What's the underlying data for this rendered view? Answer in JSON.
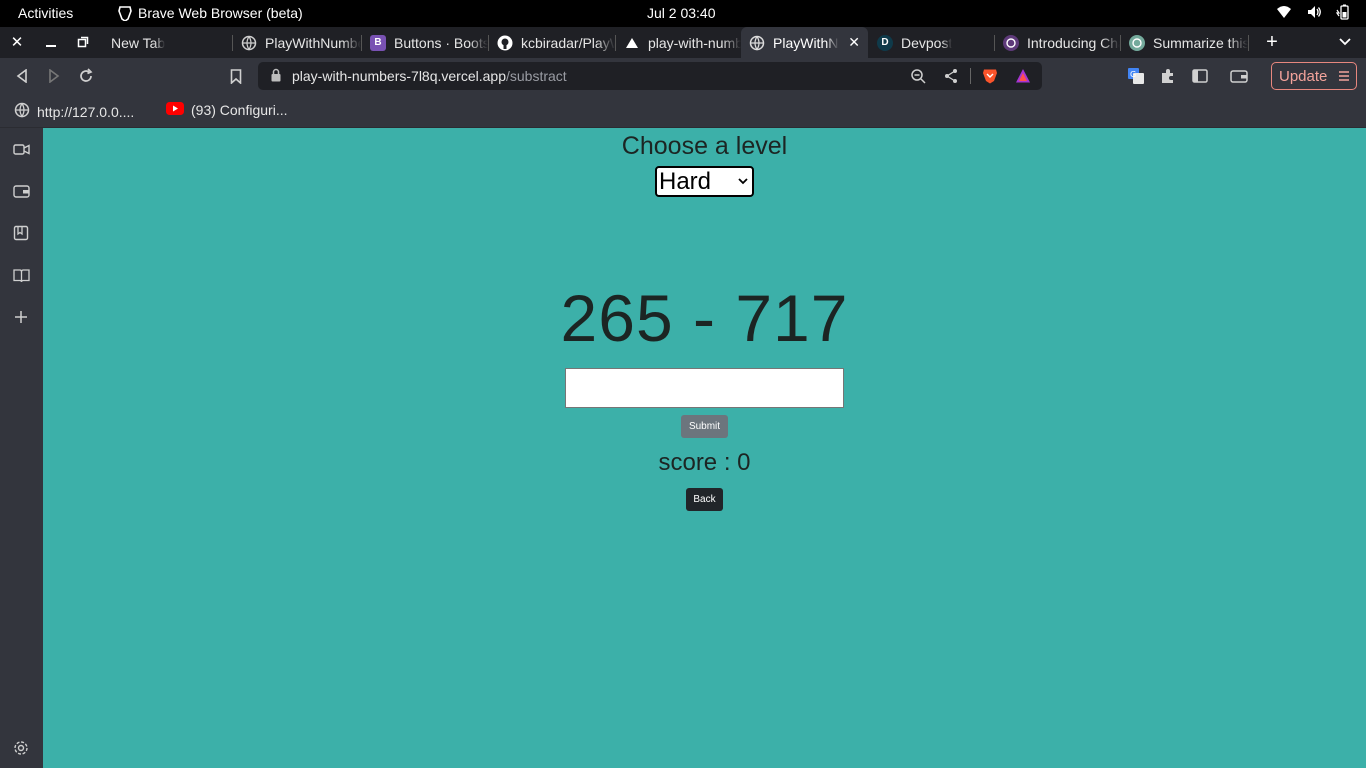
{
  "system": {
    "activities": "Activities",
    "app_name": "Brave Web Browser (beta)",
    "clock": "Jul 2  03:40"
  },
  "tabs": [
    {
      "title": "New Tab",
      "active": false
    },
    {
      "title": "PlayWithNumbers",
      "active": false
    },
    {
      "title": "Buttons · Bootstrap",
      "active": false
    },
    {
      "title": "kcbiradar/PlayWithNumbers",
      "active": false
    },
    {
      "title": "play-with-numbers",
      "active": false
    },
    {
      "title": "PlayWithNumbers",
      "active": true
    },
    {
      "title": "Devpost",
      "active": false
    },
    {
      "title": "Introducing ChatGPT",
      "active": false
    },
    {
      "title": "Summarize this",
      "active": false
    }
  ],
  "address_bar": {
    "host": "play-with-numbers-7l8q.vercel.app",
    "path": "/substract"
  },
  "update_label": "Update",
  "bookmarks": [
    {
      "label": "http://127.0.0...."
    },
    {
      "label": "(93) Configuri..."
    }
  ],
  "game": {
    "level_title": "Choose a level",
    "level_selected": "Hard",
    "problem": "265 - 717",
    "answer_value": "",
    "submit_label": "Submit",
    "score_text": "score : 0",
    "back_label": "Back"
  },
  "colors": {
    "page_background": "#3cb0a9",
    "submit_button": "#6c757d",
    "back_button": "#212529",
    "update_accent": "#e8877e"
  }
}
